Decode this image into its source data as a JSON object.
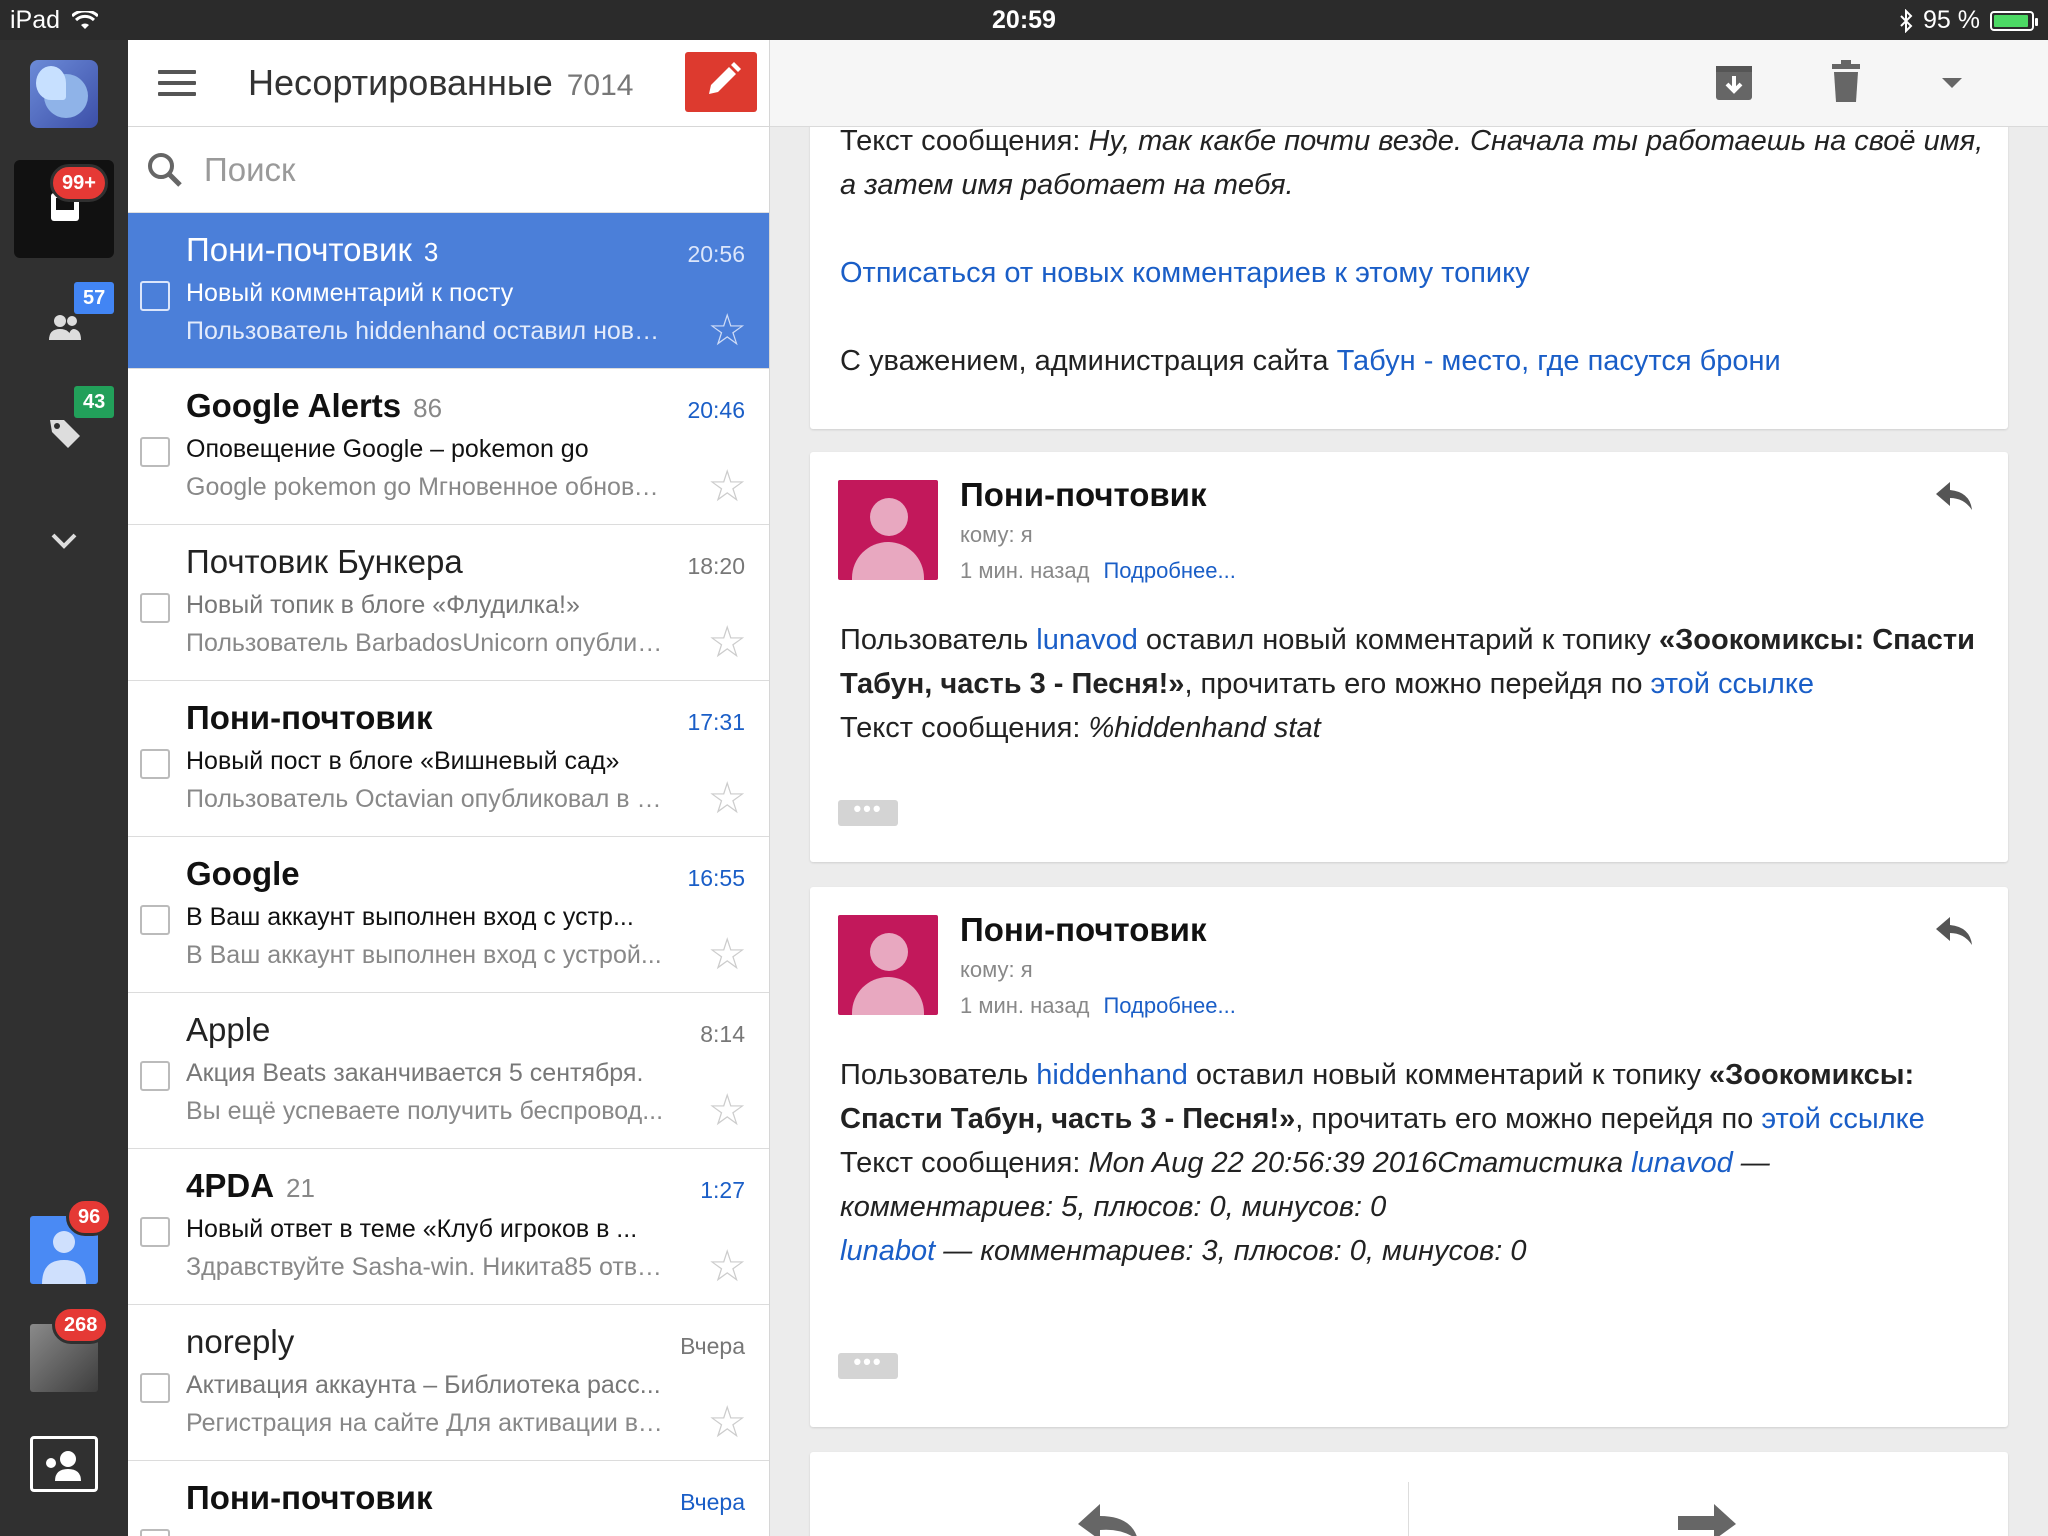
{
  "status_bar": {
    "device": "iPad",
    "time": "20:59",
    "battery": "95 %"
  },
  "rail": {
    "inbox_badge": "99+",
    "social_badge": "57",
    "promo_badge": "43",
    "account2_badge": "96",
    "account3_badge": "268"
  },
  "list_header": {
    "title": "Несортированные",
    "count": "7014"
  },
  "search": {
    "placeholder": "Поиск"
  },
  "mails": [
    {
      "sender": "Пони-почтовик",
      "count": "3",
      "time": "20:56",
      "subject": "Новый комментарий к посту",
      "snippet": "Пользователь hiddenhand оставил новы..."
    },
    {
      "sender": "Google Alerts",
      "count": "86",
      "time": "20:46",
      "subject": "Оповещение Google – pokemon go",
      "snippet": "Google pokemon go Мгновенное обновл..."
    },
    {
      "sender": "Почтовик Бункера",
      "count": "",
      "time": "18:20",
      "subject": "Новый топик в блоге «Флудилка!»",
      "snippet": "Пользователь BarbadosUnicorn опублик..."
    },
    {
      "sender": "Пони-почтовик",
      "count": "",
      "time": "17:31",
      "subject": "Новый пост в блоге «Вишневый сад»",
      "snippet": "Пользователь Octavian опубликовал в б..."
    },
    {
      "sender": "Google",
      "count": "",
      "time": "16:55",
      "subject": "В Ваш аккаунт выполнен вход с устр...",
      "snippet": "В Ваш аккаунт выполнен вход с устрой..."
    },
    {
      "sender": "Apple",
      "count": "",
      "time": "8:14",
      "subject": "Акция Beats заканчивается 5 сентября.",
      "snippet": "Вы ещё успеваете получить беспровод..."
    },
    {
      "sender": "4PDA",
      "count": "21",
      "time": "1:27",
      "subject": "Новый ответ в теме «Клуб игроков в ...",
      "snippet": "Здравствуйте Sasha-win. Никита85 отве..."
    },
    {
      "sender": "noreply",
      "count": "",
      "time": "Вчера",
      "subject": "Активация аккаунта – Библиотека расс...",
      "snippet": "Регистрация на сайте Для активации ва..."
    },
    {
      "sender": "Пони-почтовик",
      "count": "",
      "time": "Вчера",
      "subject": "",
      "snippet": ""
    }
  ],
  "reader": {
    "card0": {
      "text_label": "Текст сообщения: ",
      "text_italic": "Ну, так какбе почти везде. Сначала ты работаешь на своё имя, а затем имя работает на тебя.",
      "unsubscribe": "Отписаться от новых комментариев к этому топику",
      "regards": "С уважением, администрация сайта ",
      "site_link": "Табун - место, где пасутся брони"
    },
    "msg1": {
      "from": "Пони-почтовик",
      "to": "кому: я",
      "when": "1 мин. назад",
      "details": "Подробнее...",
      "p1": "Пользователь ",
      "user": "lunavod",
      "p2": " оставил новый комментарий к топику ",
      "topic": "«Зоокомиксы: Спасти Табун, часть 3 - Песня!»",
      "p3": ", прочитать его можно перейдя по ",
      "link": "этой ссылке",
      "text_label": "Текст сообщения: ",
      "text_italic": "%hiddenhand stat"
    },
    "msg2": {
      "from": "Пони-почтовик",
      "to": "кому: я",
      "when": "1 мин. назад",
      "details": "Подробнее...",
      "p1": "Пользователь ",
      "user": "hiddenhand",
      "p2": " оставил новый комментарий к топику ",
      "topic": "«Зоокомиксы: Спасти Табун, часть 3 - Песня!»",
      "p3": ", прочитать его можно перейдя по ",
      "link": "этой ссылке",
      "text_label": "Текст сообщения: ",
      "stat1": "Mon Aug 22 20:56:39 2016Статистика ",
      "stat_user1": "lunavod",
      "stat2": " — комментариев: 5, плюсов: 0, минусов: 0",
      "stat_user2": "lunabot",
      "stat3": " — комментариев: 3, плюсов: 0, минусов: 0"
    }
  },
  "colors": {
    "selected": "#4b7fd9",
    "compose": "#dd3a2f",
    "link": "#1a5ec7",
    "avatar": "#c2185b"
  },
  "icons": [
    "hamburger-icon",
    "pencil-icon",
    "search-icon",
    "star-icon",
    "archive-icon",
    "trash-icon",
    "dropdown-icon",
    "reply-icon",
    "forward-icon",
    "inbox-icon",
    "people-icon",
    "tag-icon",
    "chevron-down-icon",
    "contacts-icon",
    "wifi-icon",
    "bluetooth-icon"
  ]
}
